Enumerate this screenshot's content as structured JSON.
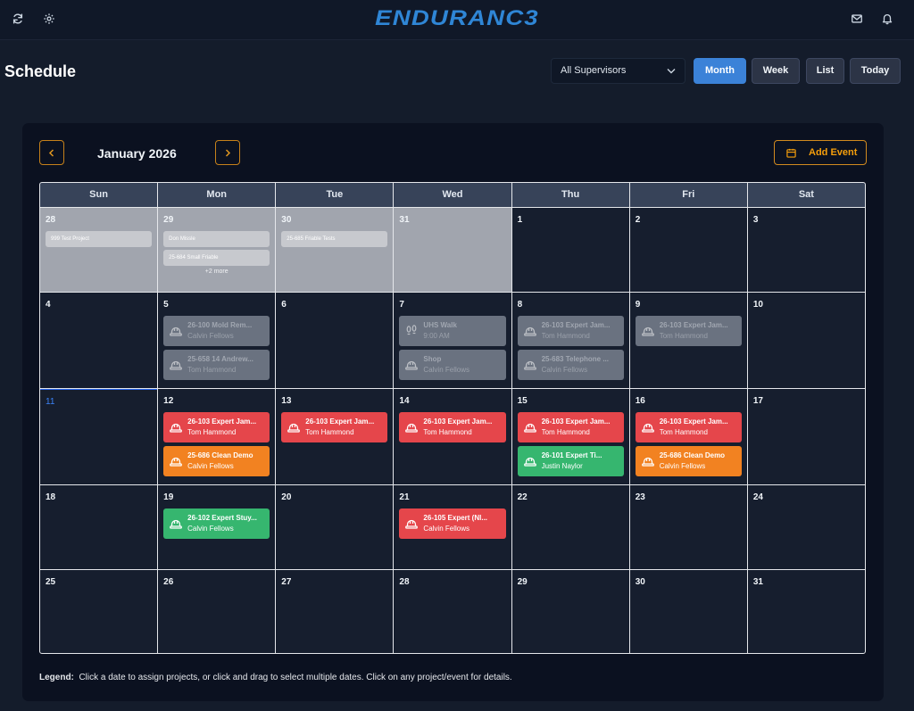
{
  "app": {
    "logo": "ENDURANC3"
  },
  "topbar": {
    "left_icons": [
      "refresh-icon",
      "gear-icon"
    ],
    "right_icons": [
      "mail-icon",
      "bell-icon"
    ]
  },
  "page": {
    "title": "Schedule"
  },
  "filters": {
    "supervisor_selected": "All Supervisors"
  },
  "views": {
    "month": "Month",
    "week": "Week",
    "list": "List",
    "today": "Today",
    "active": "Month"
  },
  "calendar": {
    "month_label": "January 2026",
    "add_event_label": "Add Event",
    "weekdays": [
      "Sun",
      "Mon",
      "Tue",
      "Wed",
      "Thu",
      "Fri",
      "Sat"
    ],
    "weeks": [
      [
        {
          "day": "28",
          "out": true,
          "pills": [
            "999 Test Project"
          ]
        },
        {
          "day": "29",
          "out": true,
          "pills": [
            "Don Missle",
            "25-684 Small Friable"
          ],
          "more": "+2 more"
        },
        {
          "day": "30",
          "out": true,
          "pills": [
            "25-685 Friable Tests"
          ]
        },
        {
          "day": "31",
          "out": true
        },
        {
          "day": "1"
        },
        {
          "day": "2"
        },
        {
          "day": "3"
        }
      ],
      [
        {
          "day": "4"
        },
        {
          "day": "5",
          "events": [
            {
              "title": "26-100 Mold Rem...",
              "sub": "Calvin Fellows",
              "color": "gray",
              "icon": "hardhat-icon"
            },
            {
              "title": "25-658 14 Andrew...",
              "sub": "Tom Hammond",
              "color": "gray",
              "icon": "hardhat-icon"
            }
          ]
        },
        {
          "day": "6"
        },
        {
          "day": "7",
          "events": [
            {
              "title": "UHS Walk",
              "sub": "9:00 AM",
              "color": "gray",
              "icon": "footprints-icon"
            },
            {
              "title": "Shop",
              "sub": "Calvin Fellows",
              "color": "gray",
              "icon": "hardhat-icon"
            }
          ]
        },
        {
          "day": "8",
          "events": [
            {
              "title": "26-103 Expert Jam...",
              "sub": "Tom Hammond",
              "color": "gray",
              "icon": "hardhat-icon"
            },
            {
              "title": "25-683 Telephone ...",
              "sub": "Calvin Fellows",
              "color": "gray",
              "icon": "hardhat-icon"
            }
          ]
        },
        {
          "day": "9",
          "events": [
            {
              "title": "26-103 Expert Jam...",
              "sub": "Tom Hammond",
              "color": "gray",
              "icon": "hardhat-icon"
            }
          ]
        },
        {
          "day": "10"
        }
      ],
      [
        {
          "day": "11",
          "today": true
        },
        {
          "day": "12",
          "events": [
            {
              "title": "26-103 Expert Jam...",
              "sub": "Tom Hammond",
              "color": "red",
              "icon": "hardhat-icon"
            },
            {
              "title": "25-686 Clean Demo",
              "sub": "Calvin Fellows",
              "color": "orange",
              "icon": "hardhat-icon"
            }
          ]
        },
        {
          "day": "13",
          "events": [
            {
              "title": "26-103 Expert Jam...",
              "sub": "Tom Hammond",
              "color": "red",
              "icon": "hardhat-icon"
            }
          ]
        },
        {
          "day": "14",
          "events": [
            {
              "title": "26-103 Expert Jam...",
              "sub": "Tom Hammond",
              "color": "red",
              "icon": "hardhat-icon"
            }
          ]
        },
        {
          "day": "15",
          "events": [
            {
              "title": "26-103 Expert Jam...",
              "sub": "Tom Hammond",
              "color": "red",
              "icon": "hardhat-icon"
            },
            {
              "title": "26-101 Expert Ti...",
              "sub": "Justin Naylor",
              "color": "green",
              "icon": "hardhat-icon"
            }
          ]
        },
        {
          "day": "16",
          "events": [
            {
              "title": "26-103 Expert Jam...",
              "sub": "Tom Hammond",
              "color": "red",
              "icon": "hardhat-icon"
            },
            {
              "title": "25-686 Clean Demo",
              "sub": "Calvin Fellows",
              "color": "orange",
              "icon": "hardhat-icon"
            }
          ]
        },
        {
          "day": "17"
        }
      ],
      [
        {
          "day": "18"
        },
        {
          "day": "19",
          "events": [
            {
              "title": "26-102 Expert Stuy...",
              "sub": "Calvin Fellows",
              "color": "green",
              "icon": "hardhat-icon"
            }
          ]
        },
        {
          "day": "20"
        },
        {
          "day": "21",
          "events": [
            {
              "title": "26-105 Expert (Nl...",
              "sub": "Calvin Fellows",
              "color": "red",
              "icon": "hardhat-icon"
            }
          ]
        },
        {
          "day": "22"
        },
        {
          "day": "23"
        },
        {
          "day": "24"
        }
      ],
      [
        {
          "day": "25"
        },
        {
          "day": "26"
        },
        {
          "day": "27"
        },
        {
          "day": "28"
        },
        {
          "day": "29"
        },
        {
          "day": "30"
        },
        {
          "day": "31"
        }
      ]
    ]
  },
  "legend": {
    "label": "Legend:",
    "text": "Click a date to assign projects, or click and drag to select multiple dates. Click on any project/event for details."
  },
  "colors": {
    "accent": "#3b82d8",
    "gold": "#f59e0b",
    "red": "#e5464b",
    "orange": "#f28221",
    "green": "#36b66f",
    "gray": "#6a7280",
    "logo": "#2f86d6"
  }
}
